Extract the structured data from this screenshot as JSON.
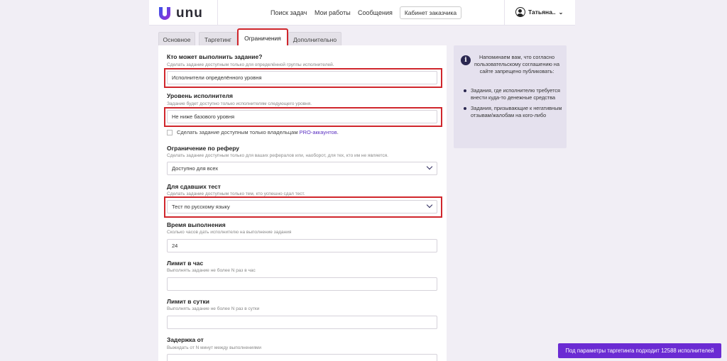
{
  "header": {
    "logo_text": "unu",
    "nav": [
      "Поиск задач",
      "Мои работы",
      "Сообщения"
    ],
    "cabinet_button": "Кабинет заказчика",
    "user_name": "Татьяна..",
    "user_chevron": "⌄"
  },
  "tabs": [
    "Основное",
    "Таргетинг",
    "Ограничения",
    "Дополнительно"
  ],
  "form": {
    "who": {
      "label": "Кто может выполнить задание?",
      "hint": "Сделать задание доступным только для определённой группы исполнителей.",
      "value": "Исполнители определённого уровня"
    },
    "level": {
      "label": "Уровень исполнителя",
      "hint": "Задание будет доступно только исполнителям следующего уровня.",
      "value": "Не ниже базового уровня"
    },
    "pro": {
      "text": "Сделать задание доступным только владельцам ",
      "link": "PRO-аккаунтов",
      "suffix": "."
    },
    "referer": {
      "label": "Ограничение по реферу",
      "hint": "Сделать задание доступным только для ваших рефералов или, наоборот, для тех, кто им не является.",
      "value": "Доступно для всех"
    },
    "test": {
      "label": "Для сдавших тест",
      "hint": "Сделать задание доступным только тем, кто успешно сдал тест.",
      "value": "Тест по русскому языку"
    },
    "time": {
      "label": "Время выполнения",
      "hint": "Сколько часов дать исполнителю на выполнение задания",
      "value": "24"
    },
    "hour_limit": {
      "label": "Лимит в час",
      "hint": "Выполнять задание не более N раз в час",
      "value": ""
    },
    "day_limit": {
      "label": "Лимит в сутки",
      "hint": "Выполнять задание не более N раз в сутки",
      "value": ""
    },
    "delay": {
      "label": "Задержка от",
      "hint": "Выжидать от N минут между выполнениями"
    }
  },
  "info": {
    "icon": "i",
    "intro": "Напоминаем вам, что согласно пользовательскому соглашению на сайте запрещено публиковать:",
    "items": [
      "Задания, где исполнителю требуется внести куда-то денежные средства",
      "Задания, призывающие к негативным отзывам/жалобам на кого-либо"
    ]
  },
  "banner": "Под параметры таргетинга подходит 12588 исполнителей",
  "colors": {
    "accent": "#6b2bd3",
    "highlight": "#d0262c",
    "dark": "#2a2750"
  }
}
